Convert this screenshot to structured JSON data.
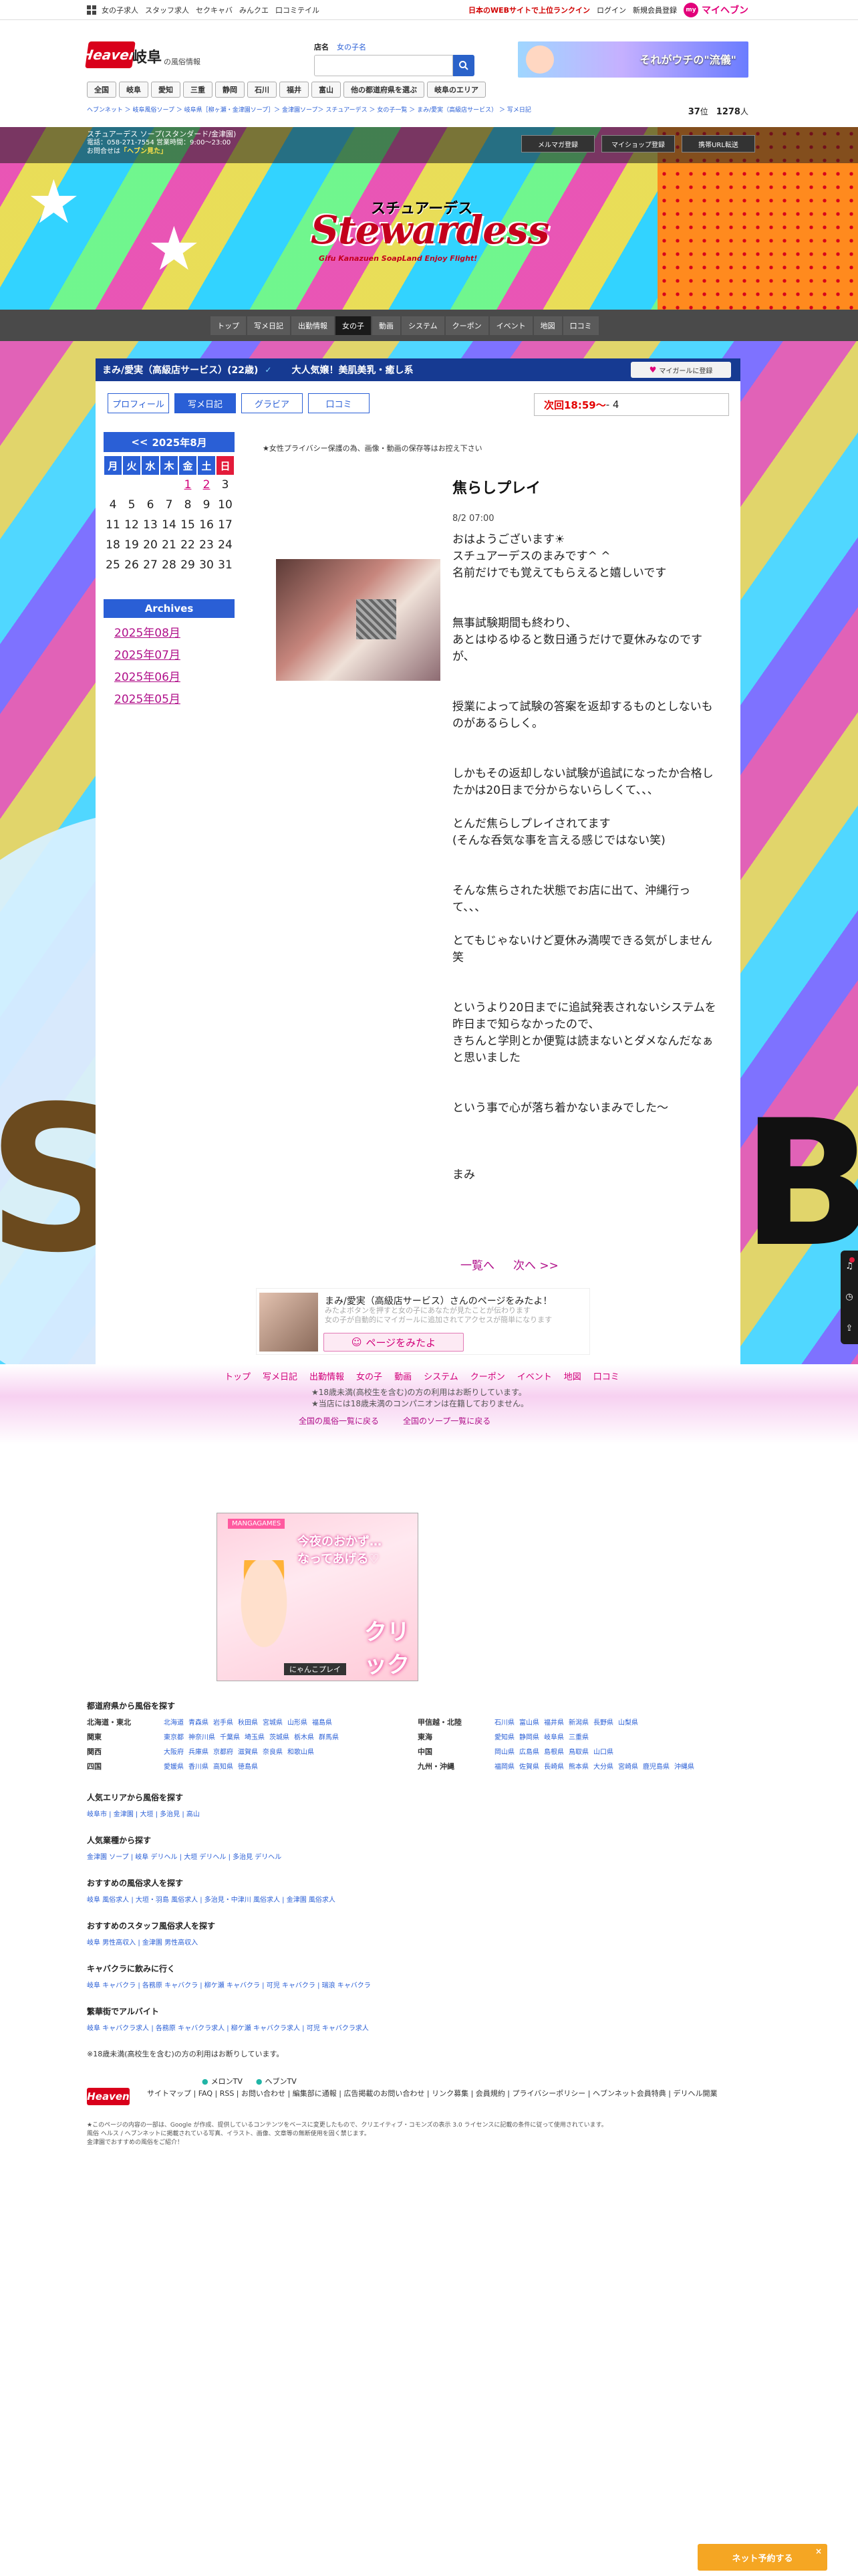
{
  "top_strip": {
    "links": [
      "女の子求人",
      "スタッフ求人",
      "セクキャバ",
      "みんクエ",
      "口コミテイル"
    ],
    "ranking_text": "日本のWEBサイトで上位ランクイン",
    "login": "ログイン",
    "register": "新規会員登録",
    "my_label": "マイヘブン",
    "my_badge": "my"
  },
  "header": {
    "logo": "Heaven",
    "area": "岐阜",
    "area_sub": "の風俗情報",
    "search_tabs": [
      "店名",
      "女の子名"
    ],
    "search_placeholder": "",
    "banner_text": "それがウチの\"流儀\"",
    "nav": [
      "全国",
      "岐阜",
      "愛知",
      "三重",
      "静岡",
      "石川",
      "福井",
      "富山",
      "他の都道府県を選ぶ",
      "岐阜のエリア"
    ],
    "breadcrumb": "ヘブンネット ＞ 岐阜風俗ソープ ＞ 岐阜県［柳ヶ瀬・金津園ソープ］＞ 金津園ソープ＞ スチュアーデス ＞ 女の子一覧 ＞ まみ/愛実（高級店サービス） ＞ 写メ日記",
    "rank_num": "37",
    "rank_label": "位",
    "fav_num": "1278",
    "fav_label": "人"
  },
  "shop": {
    "name": "スチュアーデス ソープ(スタンダード/金津園)",
    "tel": "電話：058-271-7554 営業時間：9:00～23:00",
    "note": "「ヘブン見た」",
    "note_pre": "お問合せは",
    "buttons": [
      "メルマガ登録",
      "マイショップ登録",
      "携帯URL転送"
    ],
    "logo_kana": "スチュアーデス",
    "logo_main": "Stewardess",
    "logo_sub": "Gifu Kanazuen  SoapLand  Enjoy Flight!",
    "nav": [
      "トップ",
      "写メ日記",
      "出勤情報",
      "女の子",
      "動画",
      "システム",
      "クーポン",
      "イベント",
      "地図",
      "口コミ"
    ],
    "nav_active": "女の子"
  },
  "girl": {
    "name": "まみ/愛実（高級店サービス）(22歳)",
    "check": "✓",
    "catch": "大人気嬢！美肌美乳・癒し系",
    "mygirl": "マイガールに登録",
    "tabs": [
      "プロフィール",
      "写メ日記",
      "グラビア",
      "口コミ"
    ],
    "active_tab": "写メ日記",
    "next_label": "次回18:59～",
    "next_sep": "- 4"
  },
  "calendar": {
    "title": "2025年8月",
    "prev": "<<",
    "dow": [
      "月",
      "火",
      "水",
      "木",
      "金",
      "土",
      "日"
    ],
    "weeks": [
      [
        "",
        "",
        "",
        "",
        "1",
        "2",
        "3"
      ],
      [
        "4",
        "5",
        "6",
        "7",
        "8",
        "9",
        "10"
      ],
      [
        "11",
        "12",
        "13",
        "14",
        "15",
        "16",
        "17"
      ],
      [
        "18",
        "19",
        "20",
        "21",
        "22",
        "23",
        "24"
      ],
      [
        "25",
        "26",
        "27",
        "28",
        "29",
        "30",
        "31"
      ]
    ],
    "linked_days": [
      "1",
      "2"
    ]
  },
  "archives": {
    "title": "Archives",
    "items": [
      "2025年08月",
      "2025年07月",
      "2025年06月",
      "2025年05月"
    ]
  },
  "post": {
    "privacy_note": "★女性プライバシー保護の為、画像・動画の保存等はお控え下さい",
    "title": "焦らしプレイ",
    "date": "8/2 07:00",
    "body": "おはようございます☀\nスチュアーデスのまみです^ ^\n名前だけでも覚えてもらえると嬉しいです\n\n\n無事試験期間も終わり、\nあとはゆるゆると数日通うだけで夏休みなのです\nが、\n\n\n授業によって試験の答案を返却するものとしないも\nのがあるらしく。\n\n\nしかもその返却しない試験が追試になったか合格し\nたかは20日まで分からないらしくて、、、\n\nとんだ焦らしプレイされてます\n(そんな呑気な事を言える感じではない笑)\n\n\nそんな焦らされた状態でお店に出て、沖縄行っ\nて、、、\n\nとてもじゃないけど夏休み満喫できる気がしません\n笑\n\n\nというより20日までに追試発表されないシステムを\n昨日まで知らなかったので、\nきちんと学則とか便覧は読まないとダメなんだなぁ\nと思いました\n\n\nという事で心が落ち着かないまみでした〜\n\n\n\nまみ"
  },
  "pager": {
    "list": "一覧へ",
    "next": "次へ >>"
  },
  "profile_card": {
    "name": "まみ/愛実（高級店サービス）さんのページをみたよ！",
    "sub1": "みたよボタンを押すと女の子にあなたが見たことが伝わります",
    "sub2": "女の子が自動的にマイガールに追加されてアクセスが簡単になります",
    "button": "ページをみたよ"
  },
  "bottom_nav": {
    "links": [
      "トップ",
      "写メ日記",
      "出勤情報",
      "女の子",
      "動画",
      "システム",
      "クーポン",
      "イベント",
      "地図",
      "口コミ"
    ],
    "note1": "★18歳未満(高校生を含む)の方の利用はお断りしています。",
    "note2": "★当店には18歳未満のコンパニオンは在籍しておりません。",
    "more": [
      "全国の風俗一覧に戻る",
      "全国のソープ一覧に戻る"
    ]
  },
  "ad": {
    "head": "MANGAGAMES",
    "text": "今夜のおかず…\nなってあげる♡",
    "click": "クリック",
    "foot": "にゃんこプレイ"
  },
  "directory": {
    "title": "都道府県から風俗を探す",
    "regions_left": [
      {
        "name": "北海道・東北",
        "prefs": [
          "北海道",
          "青森県",
          "岩手県",
          "秋田県",
          "宮城県",
          "山形県",
          "福島県"
        ]
      },
      {
        "name": "関東",
        "prefs": [
          "東京都",
          "神奈川県",
          "千葉県",
          "埼玉県",
          "茨城県",
          "栃木県",
          "群馬県"
        ]
      },
      {
        "name": "関西",
        "prefs": [
          "大阪府",
          "兵庫県",
          "京都府",
          "滋賀県",
          "奈良県",
          "和歌山県"
        ]
      },
      {
        "name": "四国",
        "prefs": [
          "愛媛県",
          "香川県",
          "高知県",
          "徳島県"
        ]
      }
    ],
    "regions_right": [
      {
        "name": "甲信越・北陸",
        "prefs": [
          "石川県",
          "富山県",
          "福井県",
          "新潟県",
          "長野県",
          "山梨県"
        ]
      },
      {
        "name": "東海",
        "prefs": [
          "愛知県",
          "静岡県",
          "岐阜県",
          "三重県"
        ]
      },
      {
        "name": "中国",
        "prefs": [
          "岡山県",
          "広島県",
          "島根県",
          "鳥取県",
          "山口県"
        ]
      },
      {
        "name": "九州・沖縄",
        "prefs": [
          "福岡県",
          "佐賀県",
          "長崎県",
          "熊本県",
          "大分県",
          "宮崎県",
          "鹿児島県",
          "沖縄県"
        ]
      }
    ],
    "sections": [
      {
        "title": "人気エリアから風俗を探す",
        "links": "岐阜市 | 金津園 | 大垣 | 多治見 | 高山"
      },
      {
        "title": "人気業種から探す",
        "links": "金津園 ソープ | 岐阜 デリヘル | 大垣 デリヘル | 多治見 デリヘル"
      },
      {
        "title": "おすすめの風俗求人を探す",
        "links": "岐阜 風俗求人 | 大垣・羽島 風俗求人 | 多治見・中津川 風俗求人 | 金津園 風俗求人"
      },
      {
        "title": "おすすめのスタッフ風俗求人を探す",
        "links": "岐阜 男性高収入 | 金津園 男性高収入"
      },
      {
        "title": "キャバクラに飲みに行く",
        "links": "岐阜 キャバクラ | 各務原 キャバクラ | 柳ケ瀬 キャバクラ | 可児 キャバクラ | 瑞浪 キャバクラ"
      },
      {
        "title": "繁華街でアルバイト",
        "links": "岐阜 キャバクラ求人 | 各務原 キャバクラ求人 | 柳ケ瀬 キャバクラ求人 | 可児 キャバクラ求人"
      }
    ],
    "age_note": "※18歳未満(高校生を含む)の方の利用はお断りしています。"
  },
  "footer": {
    "logo": "Heaven",
    "tv": [
      "メロンTV",
      "ヘブンTV"
    ],
    "links": "サイトマップ | FAQ | RSS | お問い合わせ | 編集部に通報 | 広告掲載のお問い合わせ | リンク募集 | 会員規約 | プライバシーポリシー | ヘブンネット会員特典 | デリヘル開業",
    "copy1": "★このページの内容の一部は、Google が作成、提供しているコンテンツをベースに変更したもので、クリエイティブ・コモンズの表示 3.0 ライセンスに記載の条件に従って使用されています。",
    "copy2": "風俗 ヘルス / ヘブンネットに掲載されている写真、イラスト、画像、文章等の無断使用を固く禁じます。",
    "copy3": "金津園でおすすめの風俗をご紹介！"
  },
  "fab": {
    "icons": [
      "bell-icon",
      "history-icon",
      "share-icon"
    ]
  },
  "fixed_button": {
    "label": "ネット予約する",
    "close": "×"
  }
}
